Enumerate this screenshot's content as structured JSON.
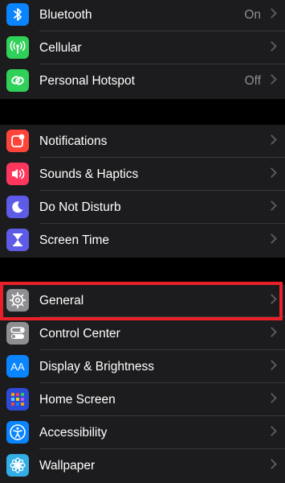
{
  "groups": [
    {
      "items": [
        {
          "label": "Bluetooth",
          "value": "On",
          "icon": "bluetooth-icon",
          "color": "#0a84ff"
        },
        {
          "label": "Cellular",
          "value": "",
          "icon": "antenna-icon",
          "color": "#30d158"
        },
        {
          "label": "Personal Hotspot",
          "value": "Off",
          "icon": "hotspot-link-icon",
          "color": "#30d158"
        }
      ]
    },
    {
      "items": [
        {
          "label": "Notifications",
          "value": "",
          "icon": "notifications-icon",
          "color": "#ff453a"
        },
        {
          "label": "Sounds & Haptics",
          "value": "",
          "icon": "speaker-icon",
          "color": "#ff375f"
        },
        {
          "label": "Do Not Disturb",
          "value": "",
          "icon": "moon-icon",
          "color": "#5e5ce6"
        },
        {
          "label": "Screen Time",
          "value": "",
          "icon": "hourglass-icon",
          "color": "#5e5ce6"
        }
      ]
    },
    {
      "items": [
        {
          "label": "General",
          "value": "",
          "icon": "gear-icon",
          "color": "#8e8e93"
        },
        {
          "label": "Control Center",
          "value": "",
          "icon": "toggles-icon",
          "color": "#8e8e93"
        },
        {
          "label": "Display & Brightness",
          "value": "",
          "icon": "aa-text-icon",
          "color": "#0a84ff"
        },
        {
          "label": "Home Screen",
          "value": "",
          "icon": "app-grid-icon",
          "color": "#2c4bd6"
        },
        {
          "label": "Accessibility",
          "value": "",
          "icon": "accessibility-icon",
          "color": "#0a84ff"
        },
        {
          "label": "Wallpaper",
          "value": "",
          "icon": "flower-icon",
          "color": "#32ade6"
        }
      ]
    }
  ],
  "icons": {
    "aa_text": "AA"
  },
  "highlight_color": "#e8202a"
}
